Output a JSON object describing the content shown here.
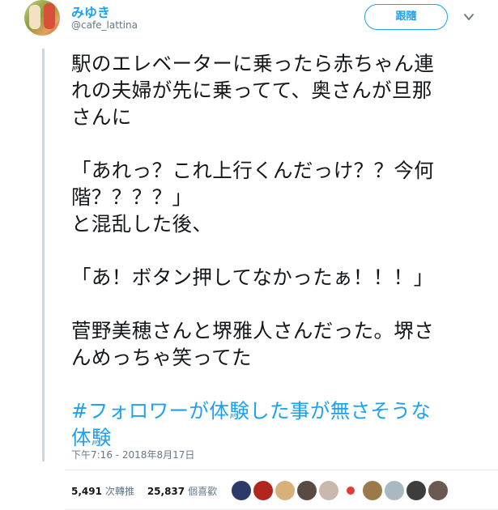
{
  "author": {
    "display_name": "みゆき",
    "handle": "@cafe_lattina"
  },
  "follow_button": {
    "label": "跟隨"
  },
  "tweet": {
    "lines": {
      "p1a": "駅のエレベーターに乗ったら赤ちゃん連",
      "p1b": "れの夫婦が先に乗ってて、奥さんが旦那",
      "p1c": "さんに",
      "p2a": "「あれっ？これ上行くんだっけ？？今何",
      "p2b": "階？？？？」",
      "p3": "と混乱した後、",
      "p4": "「あ！ボタン押してなかったぁ！！！」",
      "p5a": "菅野美穂さんと堺雅人さんだった。堺さ",
      "p5b": "んめっちゃ笑ってた",
      "hashtag_a": "#フォロワーが体験した事が無さそうな",
      "hashtag_b": "体験"
    },
    "timestamp": "下午7:16 - 2018年8月17日"
  },
  "stats": {
    "retweets_count": "5,491",
    "retweets_label": "次轉推",
    "likes_count": "25,837",
    "likes_label": "個喜歡"
  },
  "likers": [
    {
      "name": "liker-avatar-1",
      "color": "#2b3a66"
    },
    {
      "name": "liker-avatar-2",
      "color": "#b3261e"
    },
    {
      "name": "liker-avatar-3",
      "color": "#d7b07a"
    },
    {
      "name": "liker-avatar-4",
      "color": "#5a4a44"
    },
    {
      "name": "liker-avatar-5",
      "color": "#c7b9ae"
    },
    {
      "name": "liker-avatar-6",
      "color": "#e53935"
    },
    {
      "name": "liker-avatar-7",
      "color": "#9a7a4a"
    },
    {
      "name": "liker-avatar-8",
      "color": "#aab8c2"
    },
    {
      "name": "liker-avatar-9",
      "color": "#3d3d3d"
    },
    {
      "name": "liker-avatar-10",
      "color": "#6b5a52"
    }
  ],
  "colors": {
    "accent": "#1da1f2",
    "text": "#14171a",
    "muted": "#657786"
  }
}
